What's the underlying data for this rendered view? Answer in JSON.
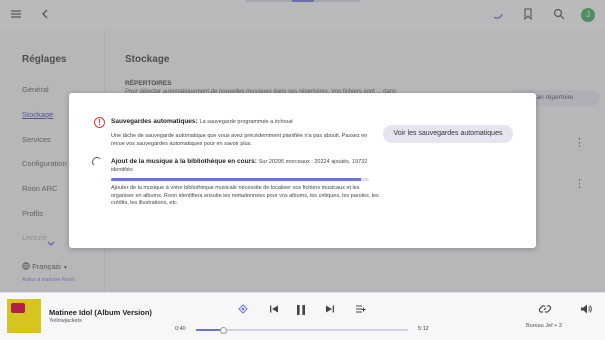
{
  "topbar": {
    "menu_icon": "hamburger-menu-icon",
    "back_icon": "back-arrow-icon",
    "activity_icon": "loading-arc-icon",
    "bookmark_icon": "bookmark-icon",
    "search_icon": "search-icon",
    "avatar_letter": "J"
  },
  "sidebar": {
    "title": "Réglages",
    "items": [
      {
        "label": "Général"
      },
      {
        "label": "Stockage"
      },
      {
        "label": "Services"
      },
      {
        "label": "Configuration"
      },
      {
        "label": "Roon ARC"
      },
      {
        "label": "Profils"
      },
      {
        "label": "Lecture"
      }
    ],
    "language": "Français",
    "help_translate": "Aidez à traduire Roon"
  },
  "main": {
    "title": "Stockage",
    "section": "RÉPERTOIRES",
    "section_text": "Pour détecter automatiquement de nouvelles musiques dans ces répertoires. Vos fichiers sont ... dans",
    "add_folder_button": "an répertoire"
  },
  "modal": {
    "backup_title": "Sauvegardes automatiques:",
    "backup_subtitle": "La sauvegarde programmée a échoué",
    "backup_body": "Une tâche de sauvegarde automatique que vous avez précédemment planifiée n'a pas abouti. Passez en revue vos sauvegardes automatiques pour en savoir plus.",
    "view_backups_button": "Voir les sauvegardes automatiques",
    "adding_title": "Ajout de la musique à la bibliothèque en cours:",
    "adding_counts": "Sur 20295 morceaux : 20224 ajoutés, 19732 identifiés",
    "adding_progress": 0.97,
    "adding_body": "Ajouter de la musique à votre bibliothèque musicale nécessite de localiser vos fichiers musicaux et les organiser en albums. Roon identifiera ensuite les métadonnées pour vos albums, les critiques, les paroles, les crédits, les illustrations, etc."
  },
  "player": {
    "track": "Matinee Idol (Album Version)",
    "artist": "Yellowjackets",
    "elapsed": "0:40",
    "duration": "5:12",
    "position_fraction": 0.128,
    "zone": "Bureau Jef + 3",
    "accent": "#6b72d8"
  }
}
